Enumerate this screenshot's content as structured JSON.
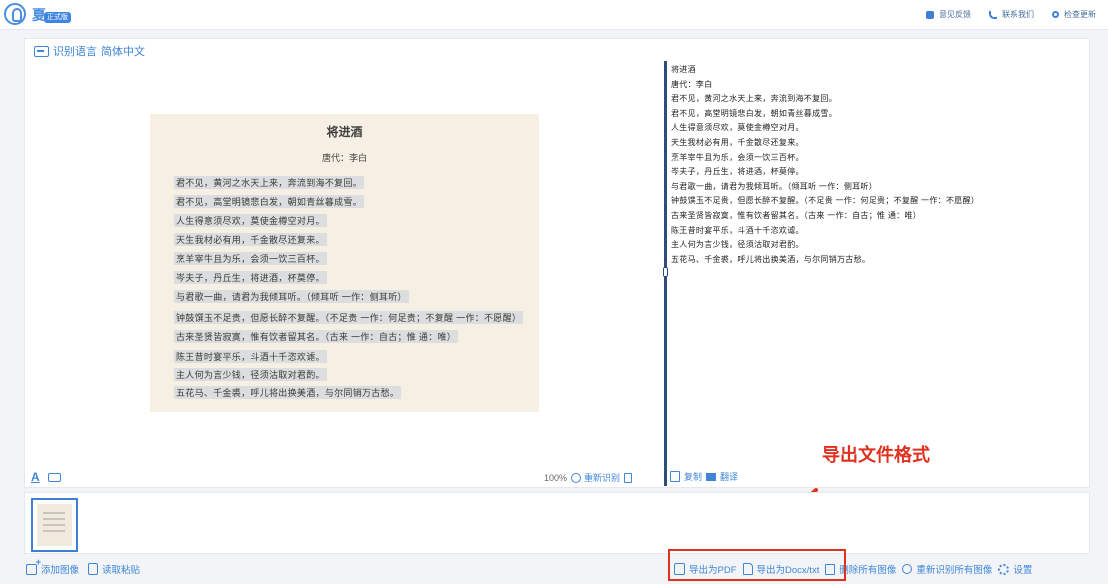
{
  "app": {
    "title": "夏",
    "badge": "正式版"
  },
  "top_actions": [
    {
      "label": "意见反馈",
      "icon": "chat-icon"
    },
    {
      "label": "联系我们",
      "icon": "phone-icon"
    },
    {
      "label": "检查更新",
      "icon": "search-icon"
    }
  ],
  "language": {
    "label": "识别语言",
    "value": "简体中文"
  },
  "document": {
    "title": "将进酒",
    "author": "唐代：李白",
    "lines": [
      "君不见，黄河之水天上来，奔流到海不复回。",
      "君不见，高堂明镜悲白发，朝如青丝暮成雪。",
      "人生得意须尽欢，莫使金樽空对月。",
      "天生我材必有用，千金散尽还复来。",
      "烹羊宰牛且为乐，会须一饮三百杯。",
      "岑夫子，丹丘生，将进酒，杯莫停。",
      "与君歌一曲，请君为我倾耳听。（倾耳听 一作：侧耳听）",
      "钟鼓馔玉不足贵，但愿长醉不复醒。（不足贵 一作：何足贵；不复醒 一作：不愿醒）",
      "古来圣贤皆寂寞，惟有饮者留其名。（古来 一作：自古；惟 通：唯）",
      "陈王昔时宴平乐，斗酒十千恣欢谑。",
      "主人何为言少钱，径须沽取对君酌。",
      "五花马、千金裘，呼儿将出换美酒，与尔同销万古愁。"
    ]
  },
  "ocr": {
    "lines": [
      "将进酒",
      "唐代：李白",
      "君不见，黄河之水天上来，奔流到海不复回。",
      "君不见，高堂明镜悲白发，朝如青丝暮成雪。",
      "人生得意须尽欢，莫使金樽空对月。",
      "天生我材必有用，千金散尽还复来。",
      "烹羊宰牛且为乐，会须一饮三百杯。",
      "岑夫子，丹丘生，将进酒，杯莫停。",
      "与君歌一曲，请君为我倾耳听。（倾耳听 一作：侧耳听）",
      "钟鼓馔玉不足贵，但愿长醉不复醒。（不足贵 一作：何足贵；不复醒 一作：不愿醒）",
      "古来圣贤皆寂寞，惟有饮者留其名。（古来 一作：自古；惟 通：唯）",
      "陈王昔时宴平乐，斗酒十千恣欢谑。",
      "主人何为言少钱，径须沽取对君酌。",
      "五花马、千金裘，呼儿将出换美酒，与尔同销万古愁。"
    ]
  },
  "left_toolbar": {
    "text_icon": "A",
    "zoom": "100%",
    "recognize": "重新识别"
  },
  "right_toolbar": {
    "copy": "复制",
    "flag": "翻译"
  },
  "footer": {
    "add_image": "添加图像",
    "clipboard": "读取粘贴",
    "export_pdf": "导出为PDF",
    "export_word": "导出为Docx/txt",
    "delete_all": "删除所有图像",
    "rerecognize_all": "重新识别所有图像",
    "settings": "设置"
  },
  "annotation": {
    "label": "导出文件格式",
    "color": "#e0311f"
  },
  "colors": {
    "accent": "#3f86d6",
    "divider": "#2f4d7a",
    "highlight": "#e0311f"
  }
}
